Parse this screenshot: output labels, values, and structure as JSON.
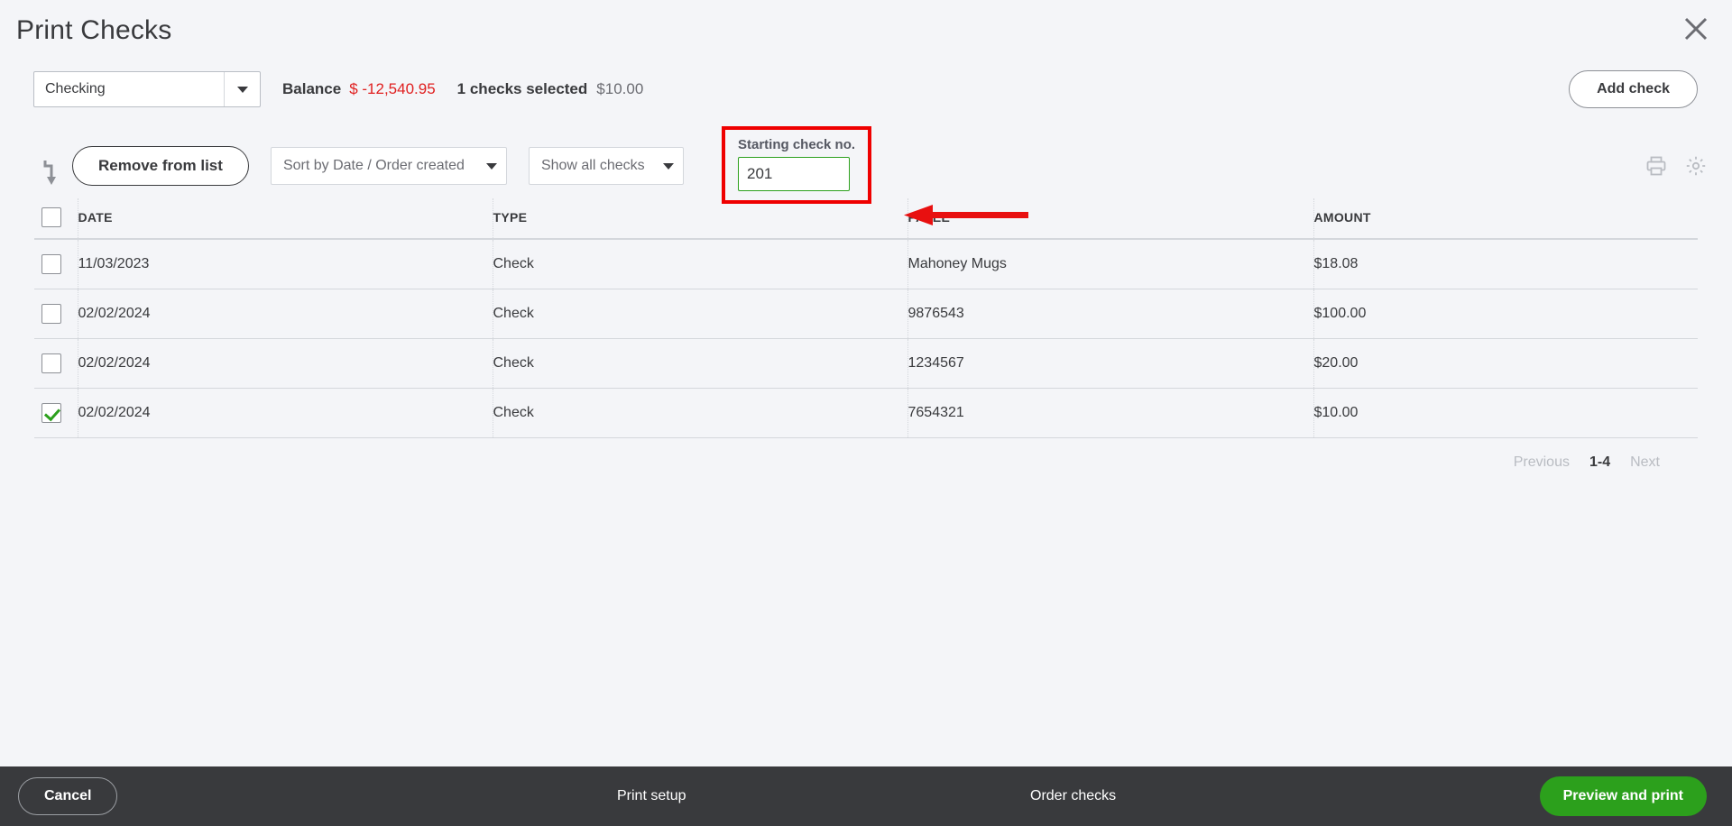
{
  "header": {
    "title": "Print Checks",
    "close_icon": "close-icon"
  },
  "account_row": {
    "account_value": "Checking",
    "balance_label": "Balance",
    "balance_value": "$ -12,540.95",
    "balance_color": "#e02020",
    "selected_count_label": "1 checks selected",
    "selected_amount": "$10.00",
    "add_check_label": "Add check"
  },
  "toolbar": {
    "sort_arrow_icon": "arrow-turn-down-icon",
    "remove_label": "Remove from list",
    "sort_select_value": "Sort by Date / Order created",
    "show_select_value": "Show all checks",
    "starting_check_label": "Starting check no.",
    "starting_check_value": "201",
    "starting_check_placeholder": "",
    "highlight_color": "#ef0000",
    "field_border_color": "#2ca01c",
    "print_icon": "printer-icon",
    "settings_icon": "gear-icon"
  },
  "table": {
    "columns": [
      "DATE",
      "TYPE",
      "PAYEE",
      "AMOUNT"
    ],
    "rows": [
      {
        "checked": false,
        "date": "11/03/2023",
        "type": "Check",
        "payee": "Mahoney Mugs",
        "amount": "$18.08"
      },
      {
        "checked": false,
        "date": "02/02/2024",
        "type": "Check",
        "payee": "9876543",
        "amount": "$100.00"
      },
      {
        "checked": false,
        "date": "02/02/2024",
        "type": "Check",
        "payee": "1234567",
        "amount": "$20.00"
      },
      {
        "checked": true,
        "date": "02/02/2024",
        "type": "Check",
        "payee": "7654321",
        "amount": "$10.00"
      }
    ]
  },
  "pagination": {
    "previous_label": "Previous",
    "range_label": "1-4",
    "next_label": "Next"
  },
  "footer": {
    "cancel_label": "Cancel",
    "print_setup_label": "Print setup",
    "order_checks_label": "Order checks",
    "preview_label": "Preview and print",
    "preview_color": "#2ca01c"
  }
}
